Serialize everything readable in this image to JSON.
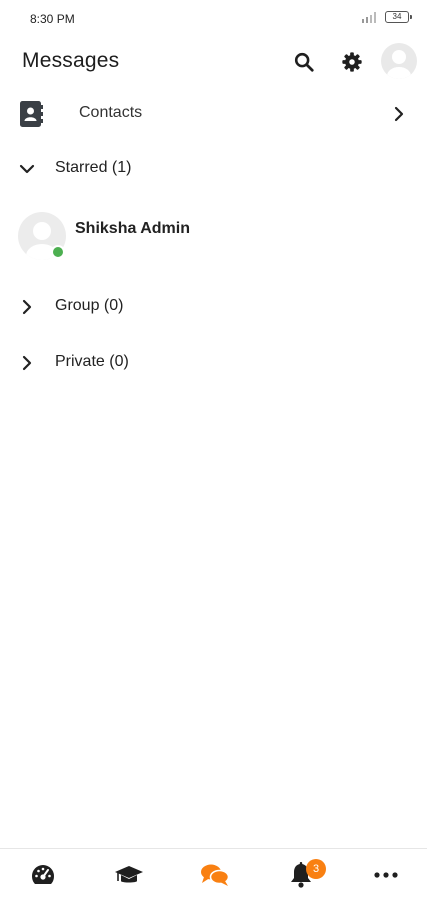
{
  "status_bar": {
    "time": "8:30 PM",
    "battery": "34"
  },
  "header": {
    "title": "Messages",
    "icons": [
      "search-icon",
      "gear-icon",
      "user-avatar"
    ]
  },
  "contacts": {
    "label": "Contacts",
    "icon": "address-book-icon"
  },
  "sections": {
    "starred": {
      "label": "Starred (1)",
      "expanded": true
    },
    "group": {
      "label": "Group (0)",
      "expanded": false
    },
    "private": {
      "label": "Private (0)",
      "expanded": false
    }
  },
  "conversations": [
    {
      "name": "Shiksha Admin",
      "online": true
    }
  ],
  "bottom_nav": {
    "items": [
      "dashboard-icon",
      "graduation-cap-icon",
      "messages-icon",
      "bell-icon",
      "more-icon"
    ],
    "active": "messages-icon",
    "notifications_badge": "3"
  },
  "colors": {
    "accent": "#f98012",
    "online": "#4caf50",
    "icon_dark": "#1f1f1f"
  }
}
